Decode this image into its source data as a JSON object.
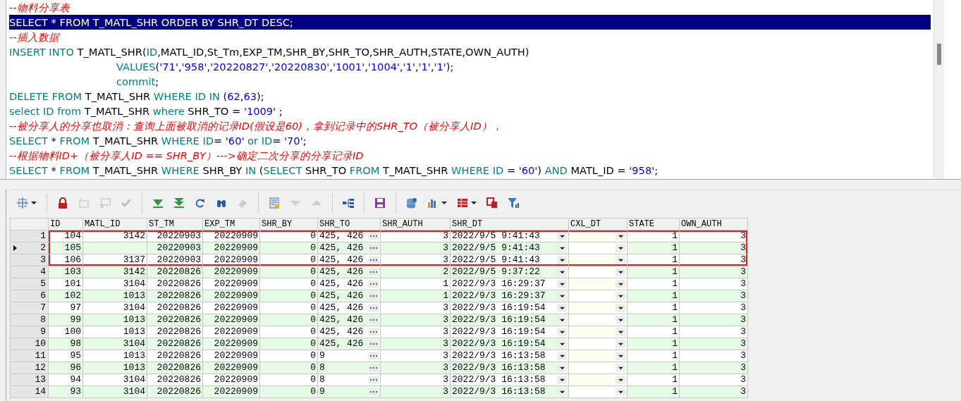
{
  "editor": {
    "lines": [
      {
        "selected": false,
        "tokens": [
          {
            "kind": "cm",
            "t": "--物料分享表"
          }
        ]
      },
      {
        "selected": true,
        "tokens": [
          {
            "kind": "kw",
            "t": "SELECT"
          },
          {
            "kind": "id",
            "t": " * "
          },
          {
            "kind": "kw",
            "t": "FROM"
          },
          {
            "kind": "id",
            "t": " T_MATL_SHR "
          },
          {
            "kind": "kw",
            "t": "ORDER BY"
          },
          {
            "kind": "id",
            "t": " SHR_DT "
          },
          {
            "kind": "kw",
            "t": "DESC"
          },
          {
            "kind": "id",
            "t": ";"
          }
        ]
      },
      {
        "selected": false,
        "tokens": [
          {
            "kind": "cm",
            "t": "--插入数据"
          }
        ]
      },
      {
        "selected": false,
        "tokens": [
          {
            "kind": "kw",
            "t": "INSERT INTO"
          },
          {
            "kind": "id",
            "t": " T_MATL_SHR("
          },
          {
            "kind": "kw",
            "t": "ID"
          },
          {
            "kind": "id",
            "t": ",MATL_ID,St_Tm,EXP_TM,SHR_BY,SHR_TO,SHR_AUTH,STATE,OWN_AUTH)"
          }
        ]
      },
      {
        "selected": false,
        "indent": true,
        "tokens": [
          {
            "kind": "kw",
            "t": "VALUES"
          },
          {
            "kind": "id",
            "t": "("
          },
          {
            "kind": "str",
            "t": "'71'"
          },
          {
            "kind": "id",
            "t": ","
          },
          {
            "kind": "str",
            "t": "'958'"
          },
          {
            "kind": "id",
            "t": ","
          },
          {
            "kind": "str",
            "t": "'20220827'"
          },
          {
            "kind": "id",
            "t": ","
          },
          {
            "kind": "str",
            "t": "'20220830'"
          },
          {
            "kind": "id",
            "t": ","
          },
          {
            "kind": "str",
            "t": "'1001'"
          },
          {
            "kind": "id",
            "t": ","
          },
          {
            "kind": "str",
            "t": "'1004'"
          },
          {
            "kind": "id",
            "t": ","
          },
          {
            "kind": "str",
            "t": "'1'"
          },
          {
            "kind": "id",
            "t": ","
          },
          {
            "kind": "str",
            "t": "'1'"
          },
          {
            "kind": "id",
            "t": ","
          },
          {
            "kind": "str",
            "t": "'1'"
          },
          {
            "kind": "id",
            "t": ");"
          }
        ]
      },
      {
        "selected": false,
        "indent": true,
        "tokens": [
          {
            "kind": "kw",
            "t": "commit"
          },
          {
            "kind": "id",
            "t": ";"
          }
        ]
      },
      {
        "selected": false,
        "tokens": [
          {
            "kind": "kw",
            "t": "DELETE FROM"
          },
          {
            "kind": "id",
            "t": " T_MATL_SHR "
          },
          {
            "kind": "kw",
            "t": "WHERE ID IN"
          },
          {
            "kind": "id",
            "t": " ("
          },
          {
            "kind": "str",
            "t": "62"
          },
          {
            "kind": "id",
            "t": ","
          },
          {
            "kind": "str",
            "t": "63"
          },
          {
            "kind": "id",
            "t": ");"
          }
        ]
      },
      {
        "selected": false,
        "tokens": [
          {
            "kind": "kw",
            "t": "select ID from"
          },
          {
            "kind": "id",
            "t": " T_MATL_SHR "
          },
          {
            "kind": "kw",
            "t": "where"
          },
          {
            "kind": "id",
            "t": " SHR_TO = "
          },
          {
            "kind": "str",
            "t": "'1009'"
          },
          {
            "kind": "id",
            "t": " ;"
          }
        ]
      },
      {
        "selected": false,
        "tokens": [
          {
            "kind": "cm",
            "t": "--被分享人的分享也取消：查询上面被取消的记录ID(假设是60)，拿到记录中的SHR_TO（被分享人ID），"
          }
        ]
      },
      {
        "selected": false,
        "tokens": [
          {
            "kind": "kw",
            "t": "SELECT"
          },
          {
            "kind": "id",
            "t": " * "
          },
          {
            "kind": "kw",
            "t": "FROM"
          },
          {
            "kind": "id",
            "t": " T_MATL_SHR "
          },
          {
            "kind": "kw",
            "t": "WHERE ID"
          },
          {
            "kind": "id",
            "t": "= "
          },
          {
            "kind": "str",
            "t": "'60'"
          },
          {
            "kind": "kw",
            "t": " or ID"
          },
          {
            "kind": "id",
            "t": "= "
          },
          {
            "kind": "str",
            "t": "'70'"
          },
          {
            "kind": "id",
            "t": ";"
          }
        ]
      },
      {
        "selected": false,
        "tokens": [
          {
            "kind": "cm",
            "t": "--根据物料ID+（被分享人ID == SHR_BY）--->确定二次分享的分享记录ID"
          }
        ]
      },
      {
        "selected": false,
        "tokens": [
          {
            "kind": "kw",
            "t": "SELECT"
          },
          {
            "kind": "id",
            "t": " * "
          },
          {
            "kind": "kw",
            "t": "FROM"
          },
          {
            "kind": "id",
            "t": " T_MATL_SHR "
          },
          {
            "kind": "kw",
            "t": "WHERE"
          },
          {
            "kind": "id",
            "t": " SHR_BY "
          },
          {
            "kind": "kw",
            "t": "IN"
          },
          {
            "kind": "id",
            "t": " ("
          },
          {
            "kind": "kw",
            "t": "SELECT"
          },
          {
            "kind": "id",
            "t": " SHR_TO "
          },
          {
            "kind": "kw",
            "t": "FROM"
          },
          {
            "kind": "id",
            "t": " T_MATL_SHR "
          },
          {
            "kind": "kw",
            "t": "WHERE ID"
          },
          {
            "kind": "id",
            "t": " = "
          },
          {
            "kind": "str",
            "t": "'60'"
          },
          {
            "kind": "id",
            "t": ") "
          },
          {
            "kind": "kw",
            "t": "AND"
          },
          {
            "kind": "id",
            "t": " MATL_ID = "
          },
          {
            "kind": "str",
            "t": "'958'"
          },
          {
            "kind": "id",
            "t": ";"
          }
        ]
      }
    ]
  },
  "table": {
    "columns": [
      {
        "label": "ID",
        "kind": "num"
      },
      {
        "label": "MATL_ID",
        "kind": "num"
      },
      {
        "label": "ST_TM",
        "kind": "text"
      },
      {
        "label": "EXP_TM",
        "kind": "text"
      },
      {
        "label": "SHR_BY",
        "kind": "num"
      },
      {
        "label": "SHR_TO",
        "kind": "ellipsis"
      },
      {
        "label": "SHR_AUTH",
        "kind": "num"
      },
      {
        "label": "SHR_DT",
        "kind": "date"
      },
      {
        "label": "CXL_DT",
        "kind": "date"
      },
      {
        "label": "STATE",
        "kind": "num"
      },
      {
        "label": "OWN_AUTH",
        "kind": "num"
      }
    ],
    "rows": [
      {
        "num": "1",
        "current": false,
        "boxed": true,
        "cells": [
          "104",
          "3142",
          "20220903",
          "20220909",
          "0",
          "425, 426",
          "3",
          "2022/9/5 9:41:43",
          null,
          "1",
          "3"
        ]
      },
      {
        "num": "2",
        "current": true,
        "boxed": true,
        "cells": [
          "105",
          null,
          "20220903",
          "20220909",
          "0",
          "425, 426",
          "3",
          "2022/9/5 9:41:43",
          null,
          "1",
          "3"
        ]
      },
      {
        "num": "3",
        "current": false,
        "boxed": true,
        "cells": [
          "106",
          "3137",
          "20220903",
          "20220909",
          "0",
          "425, 426",
          "3",
          "2022/9/5 9:41:43",
          null,
          "1",
          "3"
        ]
      },
      {
        "num": "4",
        "current": false,
        "boxed": false,
        "cells": [
          "103",
          "3142",
          "20220826",
          "20220909",
          "0",
          "425, 426",
          "2",
          "2022/9/5 9:37:22",
          null,
          "1",
          "3"
        ]
      },
      {
        "num": "5",
        "current": false,
        "boxed": false,
        "cells": [
          "101",
          "3104",
          "20220826",
          "20220909",
          "0",
          "425, 426",
          "1",
          "2022/9/3 16:29:37",
          null,
          "1",
          "3"
        ]
      },
      {
        "num": "6",
        "current": false,
        "boxed": false,
        "cells": [
          "102",
          "1013",
          "20220826",
          "20220909",
          "0",
          "425, 426",
          "1",
          "2022/9/3 16:29:37",
          null,
          "1",
          "3"
        ]
      },
      {
        "num": "7",
        "current": false,
        "boxed": false,
        "cells": [
          "97",
          "3104",
          "20220826",
          "20220909",
          "0",
          "425, 426",
          "3",
          "2022/9/3 16:19:54",
          null,
          "1",
          "3"
        ]
      },
      {
        "num": "8",
        "current": false,
        "boxed": false,
        "cells": [
          "99",
          "1013",
          "20220826",
          "20220909",
          "0",
          "425, 426",
          "3",
          "2022/9/3 16:19:54",
          null,
          "1",
          "3"
        ]
      },
      {
        "num": "9",
        "current": false,
        "boxed": false,
        "cells": [
          "100",
          "1013",
          "20220826",
          "20220909",
          "0",
          "425, 426",
          "3",
          "2022/9/3 16:19:54",
          null,
          "1",
          "3"
        ]
      },
      {
        "num": "10",
        "current": false,
        "boxed": false,
        "cells": [
          "98",
          "3104",
          "20220826",
          "20220909",
          "0",
          "425, 426",
          "3",
          "2022/9/3 16:19:54",
          null,
          "1",
          "3"
        ]
      },
      {
        "num": "11",
        "current": false,
        "boxed": false,
        "cells": [
          "95",
          "1013",
          "20220826",
          "20220909",
          "0",
          "9",
          "3",
          "2022/9/3 16:13:58",
          null,
          "1",
          "3"
        ]
      },
      {
        "num": "12",
        "current": false,
        "boxed": false,
        "cells": [
          "96",
          "1013",
          "20220826",
          "20220909",
          "0",
          "8",
          "3",
          "2022/9/3 16:13:58",
          null,
          "1",
          "3"
        ]
      },
      {
        "num": "13",
        "current": false,
        "boxed": false,
        "cells": [
          "94",
          "3104",
          "20220826",
          "20220909",
          "0",
          "8",
          "3",
          "2022/9/3 16:13:58",
          null,
          "1",
          "3"
        ]
      },
      {
        "num": "14",
        "current": false,
        "boxed": false,
        "cells": [
          "93",
          "3104",
          "20220826",
          "20220909",
          "0",
          "9",
          "3",
          "2022/9/3 16:13:58",
          null,
          "1",
          "3"
        ]
      }
    ]
  }
}
